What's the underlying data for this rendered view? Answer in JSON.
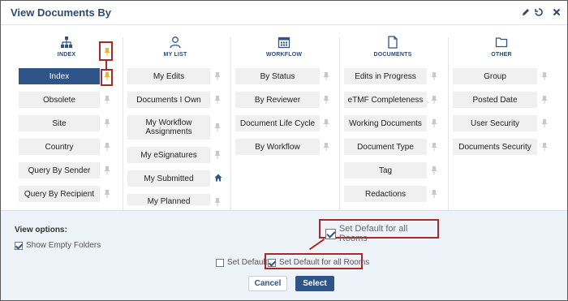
{
  "dialog": {
    "title": "View Documents By"
  },
  "header_icons": [
    "pencil-icon",
    "reset-icon",
    "close-icon"
  ],
  "columns": [
    {
      "label": "INDEX",
      "icon": "hierarchy-icon",
      "items": [
        "Index",
        "Obsolete",
        "Site",
        "Country",
        "Query By Sender",
        "Query By Recipient"
      ],
      "active": "Index"
    },
    {
      "label": "MY LIST",
      "icon": "user-icon",
      "items": [
        "My Edits",
        "Documents I Own",
        "My Workflow Assignments",
        "My eSignatures",
        "My Submitted",
        "My Planned"
      ]
    },
    {
      "label": "WORKFLOW",
      "icon": "calendar-icon",
      "items": [
        "By Status",
        "By Reviewer",
        "Document Life Cycle",
        "By Workflow"
      ]
    },
    {
      "label": "DOCUMENTS",
      "icon": "document-icon",
      "items": [
        "Edits in Progress",
        "eTMF Completeness",
        "Working Documents",
        "Document Type",
        "Tag",
        "Redactions"
      ]
    },
    {
      "label": "OTHER",
      "icon": "folder-icon",
      "items": [
        "Group",
        "Posted Date",
        "User Security",
        "Documents Security"
      ]
    }
  ],
  "footer": {
    "view_options_label": "View options:",
    "show_empty_folders": "Show Empty Folders",
    "set_default": "Set Default",
    "set_default_all_rooms": "Set Default for all Rooms",
    "callout_set_default_all_rooms": "Set Default for all Rooms",
    "cancel_label": "Cancel",
    "select_label": "Select"
  },
  "colors": {
    "accent": "#2e5488",
    "pin_highlight": "#f0b429",
    "callout": "#a52a2a",
    "footer_bg": "#eef3f9"
  }
}
